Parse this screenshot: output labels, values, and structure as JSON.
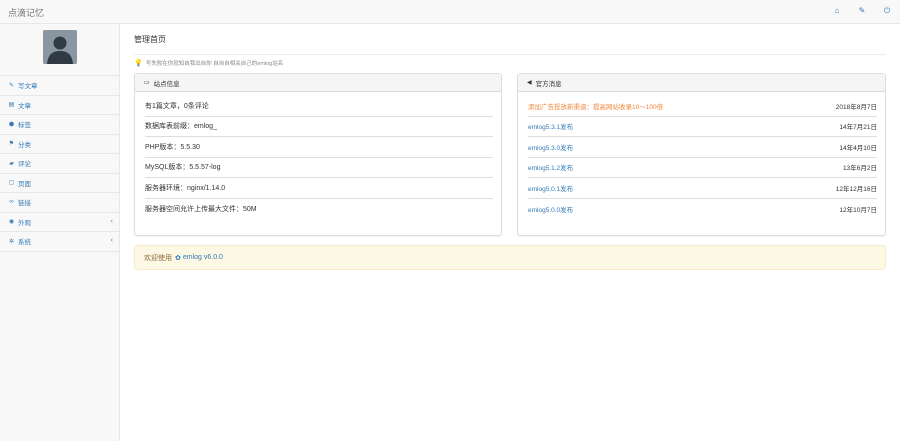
{
  "header": {
    "brand": "点滴记忆",
    "icons": [
      "home-icon",
      "wrench-icon",
      "power-icon"
    ]
  },
  "sidebar": {
    "items": [
      {
        "label": "写文章",
        "icon": "pencil-icon",
        "glyph": "✎"
      },
      {
        "label": "文章",
        "icon": "list-icon",
        "glyph": "▤"
      },
      {
        "label": "标签",
        "icon": "tags-icon",
        "glyph": "⬢"
      },
      {
        "label": "分类",
        "icon": "flag-icon",
        "glyph": "⚑"
      },
      {
        "label": "评论",
        "icon": "comments-icon",
        "glyph": "▰"
      },
      {
        "label": "页面",
        "icon": "file-icon",
        "glyph": "▢"
      },
      {
        "label": "链接",
        "icon": "link-icon",
        "glyph": "∞"
      },
      {
        "label": "外观",
        "icon": "eye-icon",
        "glyph": "◉",
        "caret": "‹"
      },
      {
        "label": "系统",
        "icon": "cog-icon",
        "glyph": "✲",
        "caret": "‹"
      }
    ]
  },
  "main": {
    "title": "管理首页",
    "tip": "写失败在你就知自我出自你 自自自相关自己的emlog站名",
    "site_info": {
      "heading": "站点信息",
      "rows": [
        "有1篇文章，0条评论",
        "数据库表前缀：emlog_",
        "PHP版本：5.5.30",
        "MySQL版本：5.5.57-log",
        "服务器环境：nginx/1.14.0",
        "服务器空间允许上传最大文件：50M"
      ]
    },
    "official_news": {
      "heading": "官方消息",
      "items": [
        {
          "title": "添加广告投放新渠道：提高网站收录10～100倍",
          "date": "2018年8月7日",
          "hot": true
        },
        {
          "title": "emlog5.3.1发布",
          "date": "14年7月21日",
          "hot": false
        },
        {
          "title": "emlog5.3.0发布",
          "date": "14年4月10日",
          "hot": false
        },
        {
          "title": "emlog5.1.2发布",
          "date": "13年6月2日",
          "hot": false
        },
        {
          "title": "emlog5.0.1发布",
          "date": "12年12月16日",
          "hot": false
        },
        {
          "title": "emlog5.0.0发布",
          "date": "12年10月7日",
          "hot": false
        }
      ]
    },
    "welcome": {
      "prefix": "欢迎使用",
      "version": "emlog v6.0.0"
    }
  },
  "colors": {
    "link": "#337ab7",
    "hot_link": "#f0883a",
    "welcome_bg": "#fcf8e3",
    "welcome_text": "#8a6d3b"
  }
}
